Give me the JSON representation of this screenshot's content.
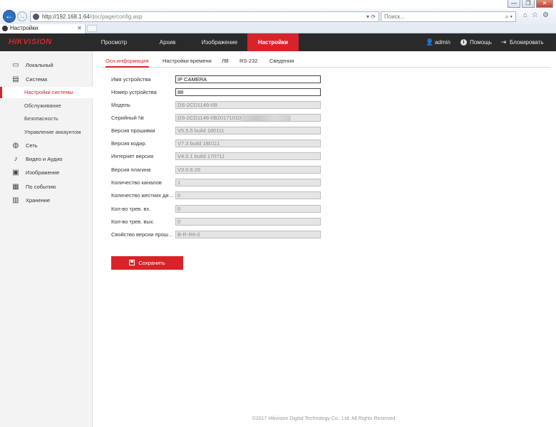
{
  "browser": {
    "url_host": "http://192.168.1.64",
    "url_path": "/doc/page/config.asp",
    "url_icons": "▾ ⟳",
    "search_placeholder": "Поиск...",
    "search_icons": "⌕ ▾",
    "tab_title": "Настройки",
    "tab_close": "✕",
    "window_controls": {
      "minimize": "—",
      "maximize": "❐",
      "close": "✕"
    },
    "tools": {
      "home": "⌂",
      "favorites": "☆",
      "settings": "⚙"
    }
  },
  "header": {
    "logo": "HIKVISION",
    "menu": [
      "Просмотр",
      "Архив",
      "Изображение",
      "Настройки"
    ],
    "active_menu": "Настройки",
    "user": "admin",
    "help": "Помощь",
    "logout": "Блокировать"
  },
  "sidebar": {
    "local": "Локальный",
    "system": "Система",
    "system_settings": "Настройки системы",
    "maintenance": "Обслуживание",
    "security": "Безопасность",
    "user_management": "Управление аккаунтом",
    "network": "Сеть",
    "video_audio": "Видео и Аудио",
    "image": "Изображение",
    "event": "По событию",
    "storage": "Хранение"
  },
  "subtabs": [
    "Осн.информация",
    "Настройки времени",
    "ЛВ",
    "RS-232",
    "Сведения"
  ],
  "form": [
    {
      "label": "Имя устройства",
      "value": "IP CAMERA",
      "editable": true
    },
    {
      "label": "Номер устройства",
      "value": "88",
      "editable": true
    },
    {
      "label": "Модель",
      "value": "DS-2CD1148-I/B",
      "editable": false
    },
    {
      "label": "Серийный №",
      "value": "DS-2CD1148-I/B20171010",
      "editable": false
    },
    {
      "label": "Версия прошивки",
      "value": "V5.5.5 build 180111",
      "editable": false
    },
    {
      "label": "Версия кодир.",
      "value": "V7.3 build 180111",
      "editable": false
    },
    {
      "label": "Интернет версия",
      "value": "V4.0.1 build 170711",
      "editable": false
    },
    {
      "label": "Версия плагина",
      "value": "V3.0.6.26",
      "editable": false
    },
    {
      "label": "Количество каналов",
      "value": "1",
      "editable": false
    },
    {
      "label": "Количество жестких дис...",
      "value": "0",
      "editable": false
    },
    {
      "label": "Кол-во трев. вх.",
      "value": "0",
      "editable": false
    },
    {
      "label": "Кол-во трев. вых.",
      "value": "0",
      "editable": false
    },
    {
      "label": "Свойство версии проши...",
      "value": "B-R-R6-0",
      "editable": false
    }
  ],
  "save_label": "Сохранить",
  "footer": "©2017 Hikvision Digital Technology Co., Ltd. All Rights Reserved."
}
